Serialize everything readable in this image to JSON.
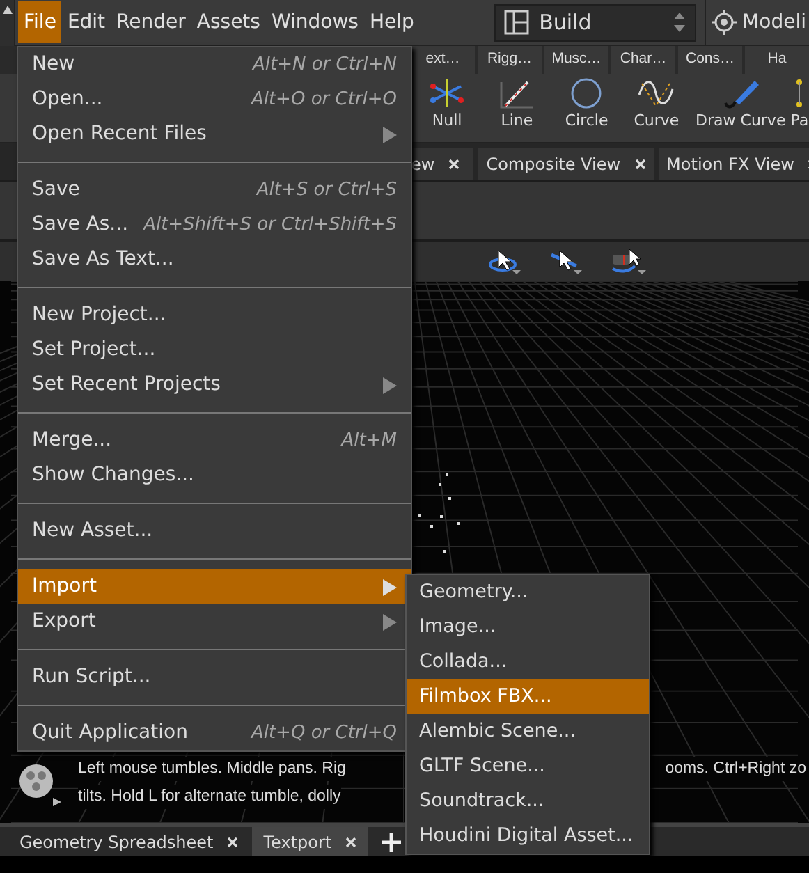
{
  "menubar": {
    "items": [
      {
        "label": "File",
        "selected": true
      },
      {
        "label": "Edit",
        "selected": false
      },
      {
        "label": "Render",
        "selected": false
      },
      {
        "label": "Assets",
        "selected": false
      },
      {
        "label": "Windows",
        "selected": false
      },
      {
        "label": "Help",
        "selected": false
      }
    ],
    "desktop": "Build",
    "context": "Modeli"
  },
  "shelf_tabs": [
    "ext…",
    "Rigg…",
    "Musc…",
    "Char…",
    "Cons…",
    "Ha"
  ],
  "tools": [
    "Null",
    "Line",
    "Circle",
    "Curve",
    "Draw Curve",
    "Pa"
  ],
  "pane_tabs": [
    "ew",
    "Composite View",
    "Motion FX View"
  ],
  "viewport": {
    "hint_lines": [
      [
        "Left mouse tumbles. Middle pans. Rig",
        "ooms. Ctrl+Right zo"
      ],
      [
        "tilts. Hold L for alternate tumble, dolly"
      ]
    ]
  },
  "bottom_tabs": [
    {
      "label": "Geometry Spreadsheet",
      "selected": false
    },
    {
      "label": "Textport",
      "selected": true
    }
  ],
  "file_menu": [
    {
      "kind": "item",
      "label": "New",
      "shortcut": "Alt+N or Ctrl+N",
      "submenu": false,
      "selected": false
    },
    {
      "kind": "item",
      "label": "Open...",
      "shortcut": "Alt+O or Ctrl+O",
      "submenu": false,
      "selected": false
    },
    {
      "kind": "item",
      "label": "Open Recent Files",
      "submenu": true,
      "selected": false
    },
    {
      "kind": "separator"
    },
    {
      "kind": "item",
      "label": "Save",
      "shortcut": "Alt+S or Ctrl+S",
      "submenu": false,
      "selected": false
    },
    {
      "kind": "item",
      "label": "Save As...",
      "shortcut": "Alt+Shift+S or Ctrl+Shift+S",
      "submenu": false,
      "selected": false
    },
    {
      "kind": "item",
      "label": "Save As Text...",
      "submenu": false,
      "selected": false
    },
    {
      "kind": "separator"
    },
    {
      "kind": "item",
      "label": "New Project...",
      "submenu": false,
      "selected": false
    },
    {
      "kind": "item",
      "label": "Set Project...",
      "submenu": false,
      "selected": false
    },
    {
      "kind": "item",
      "label": "Set Recent Projects",
      "submenu": true,
      "selected": false
    },
    {
      "kind": "separator"
    },
    {
      "kind": "item",
      "label": "Merge...",
      "shortcut": "Alt+M",
      "submenu": false,
      "selected": false
    },
    {
      "kind": "item",
      "label": "Show Changes...",
      "submenu": false,
      "selected": false
    },
    {
      "kind": "separator"
    },
    {
      "kind": "item",
      "label": "New Asset...",
      "submenu": false,
      "selected": false
    },
    {
      "kind": "separator"
    },
    {
      "kind": "item",
      "label": "Import",
      "submenu": true,
      "selected": true
    },
    {
      "kind": "item",
      "label": "Export",
      "submenu": true,
      "selected": false
    },
    {
      "kind": "separator"
    },
    {
      "kind": "item",
      "label": "Run Script...",
      "submenu": false,
      "selected": false
    },
    {
      "kind": "separator"
    },
    {
      "kind": "item",
      "label": "Quit Application",
      "shortcut": "Alt+Q or Ctrl+Q",
      "submenu": false,
      "selected": false
    }
  ],
  "import_submenu": [
    {
      "label": "Geometry...",
      "selected": false
    },
    {
      "label": "Image...",
      "selected": false
    },
    {
      "label": "Collada...",
      "selected": false
    },
    {
      "label": "Filmbox FBX...",
      "selected": true
    },
    {
      "label": "Alembic Scene...",
      "selected": false
    },
    {
      "label": "GLTF Scene...",
      "selected": false
    },
    {
      "label": "Soundtrack...",
      "selected": false
    },
    {
      "label": "Houdini Digital Asset...",
      "selected": false
    }
  ]
}
